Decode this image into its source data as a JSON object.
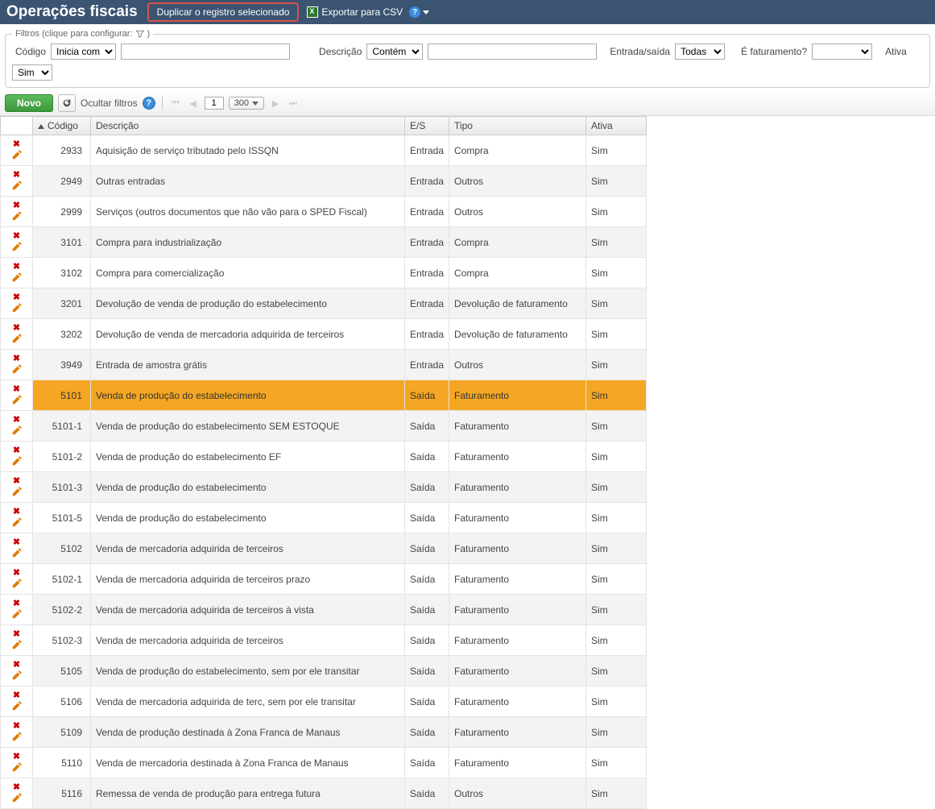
{
  "header": {
    "title": "Operações fiscais",
    "duplicate_btn": "Duplicar o registro selecionado",
    "export_csv": "Exportar para CSV"
  },
  "filters": {
    "legend": "Filtros (clique para configurar:",
    "legend_close": ")",
    "codigo_label": "Código",
    "codigo_op": "Inicia com",
    "codigo_value": "",
    "descricao_label": "Descrição",
    "descricao_op": "Contém",
    "descricao_value": "",
    "es_label": "Entrada/saída",
    "es_value": "Todas",
    "faturamento_label": "É faturamento?",
    "faturamento_value": "",
    "ativa_label": "Ativa",
    "ativa_value": "Sim"
  },
  "toolbar": {
    "novo": "Novo",
    "ocultar": "Ocultar filtros",
    "page": "1",
    "page_size": "300"
  },
  "grid": {
    "headers": {
      "codigo": "Código",
      "descricao": "Descrição",
      "es": "E/S",
      "tipo": "Tipo",
      "ativa": "Ativa"
    },
    "rows": [
      {
        "codigo": "2933",
        "descricao": "Aquisição de serviço tributado pelo ISSQN",
        "es": "Entrada",
        "tipo": "Compra",
        "ativa": "Sim",
        "selected": false
      },
      {
        "codigo": "2949",
        "descricao": "Outras entradas",
        "es": "Entrada",
        "tipo": "Outros",
        "ativa": "Sim",
        "selected": false
      },
      {
        "codigo": "2999",
        "descricao": "Serviços (outros documentos que não vão para o SPED Fiscal)",
        "es": "Entrada",
        "tipo": "Outros",
        "ativa": "Sim",
        "selected": false
      },
      {
        "codigo": "3101",
        "descricao": "Compra para industrialização",
        "es": "Entrada",
        "tipo": "Compra",
        "ativa": "Sim",
        "selected": false
      },
      {
        "codigo": "3102",
        "descricao": "Compra para comercialização",
        "es": "Entrada",
        "tipo": "Compra",
        "ativa": "Sim",
        "selected": false
      },
      {
        "codigo": "3201",
        "descricao": "Devolução de venda de produção do estabelecimento",
        "es": "Entrada",
        "tipo": "Devolução de faturamento",
        "ativa": "Sim",
        "selected": false
      },
      {
        "codigo": "3202",
        "descricao": "Devolução de venda de mercadoria adquirida de terceiros",
        "es": "Entrada",
        "tipo": "Devolução de faturamento",
        "ativa": "Sim",
        "selected": false
      },
      {
        "codigo": "3949",
        "descricao": "Entrada de amostra grátis",
        "es": "Entrada",
        "tipo": "Outros",
        "ativa": "Sim",
        "selected": false
      },
      {
        "codigo": "5101",
        "descricao": "Venda de produção do estabelecimento",
        "es": "Saída",
        "tipo": "Faturamento",
        "ativa": "Sim",
        "selected": true
      },
      {
        "codigo": "5101-1",
        "descricao": "Venda de produção do estabelecimento SEM ESTOQUE",
        "es": "Saída",
        "tipo": "Faturamento",
        "ativa": "Sim",
        "selected": false
      },
      {
        "codigo": "5101-2",
        "descricao": "Venda de produção do estabelecimento EF",
        "es": "Saída",
        "tipo": "Faturamento",
        "ativa": "Sim",
        "selected": false
      },
      {
        "codigo": "5101-3",
        "descricao": "Venda de produção do estabelecimento",
        "es": "Saída",
        "tipo": "Faturamento",
        "ativa": "Sim",
        "selected": false
      },
      {
        "codigo": "5101-5",
        "descricao": "Venda de produção do estabelecimento",
        "es": "Saída",
        "tipo": "Faturamento",
        "ativa": "Sim",
        "selected": false
      },
      {
        "codigo": "5102",
        "descricao": "Venda de mercadoria adquirida de terceiros",
        "es": "Saída",
        "tipo": "Faturamento",
        "ativa": "Sim",
        "selected": false
      },
      {
        "codigo": "5102-1",
        "descricao": "Venda de mercadoria adquirida de terceiros prazo",
        "es": "Saída",
        "tipo": "Faturamento",
        "ativa": "Sim",
        "selected": false
      },
      {
        "codigo": "5102-2",
        "descricao": "Venda de mercadoria adquirida de terceiros à vista",
        "es": "Saída",
        "tipo": "Faturamento",
        "ativa": "Sim",
        "selected": false
      },
      {
        "codigo": "5102-3",
        "descricao": "Venda de mercadoria adquirida de terceiros",
        "es": "Saída",
        "tipo": "Faturamento",
        "ativa": "Sim",
        "selected": false
      },
      {
        "codigo": "5105",
        "descricao": "Venda de produção do estabelecimento, sem por ele transitar",
        "es": "Saída",
        "tipo": "Faturamento",
        "ativa": "Sim",
        "selected": false
      },
      {
        "codigo": "5106",
        "descricao": "Venda de mercadoria adquirida de terc, sem por ele transitar",
        "es": "Saída",
        "tipo": "Faturamento",
        "ativa": "Sim",
        "selected": false
      },
      {
        "codigo": "5109",
        "descricao": "Venda de produção destinada à Zona Franca de Manaus",
        "es": "Saída",
        "tipo": "Faturamento",
        "ativa": "Sim",
        "selected": false
      },
      {
        "codigo": "5110",
        "descricao": "Venda de mercadoria destinada à Zona Franca de Manaus",
        "es": "Saída",
        "tipo": "Faturamento",
        "ativa": "Sim",
        "selected": false
      },
      {
        "codigo": "5116",
        "descricao": "Remessa de venda de produção para entrega futura",
        "es": "Saída",
        "tipo": "Outros",
        "ativa": "Sim",
        "selected": false
      }
    ]
  }
}
